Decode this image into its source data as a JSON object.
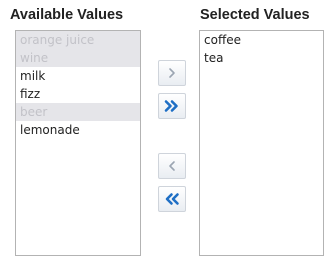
{
  "available": {
    "heading": "Available Values",
    "items": [
      {
        "label": "orange juice",
        "enabled": false
      },
      {
        "label": "wine",
        "enabled": false
      },
      {
        "label": "milk",
        "enabled": true
      },
      {
        "label": "fizz",
        "enabled": true
      },
      {
        "label": "beer",
        "enabled": false
      },
      {
        "label": "lemonade",
        "enabled": true
      }
    ]
  },
  "selected": {
    "heading": "Selected Values",
    "items": [
      {
        "label": "coffee"
      },
      {
        "label": "tea"
      }
    ]
  },
  "buttons": {
    "move": {
      "icon": "chevron-right-icon",
      "enabled": false
    },
    "move_all": {
      "icon": "double-chevron-right-icon",
      "enabled": true
    },
    "remove": {
      "icon": "chevron-left-icon",
      "enabled": false
    },
    "remove_all": {
      "icon": "double-chevron-left-icon",
      "enabled": true
    }
  },
  "colors": {
    "enabled_arrow": "#1f6fc5",
    "disabled_arrow": "#9ba5b2",
    "disabled_row_bg": "#e5e5e9",
    "disabled_row_text": "#c2c2c8"
  }
}
